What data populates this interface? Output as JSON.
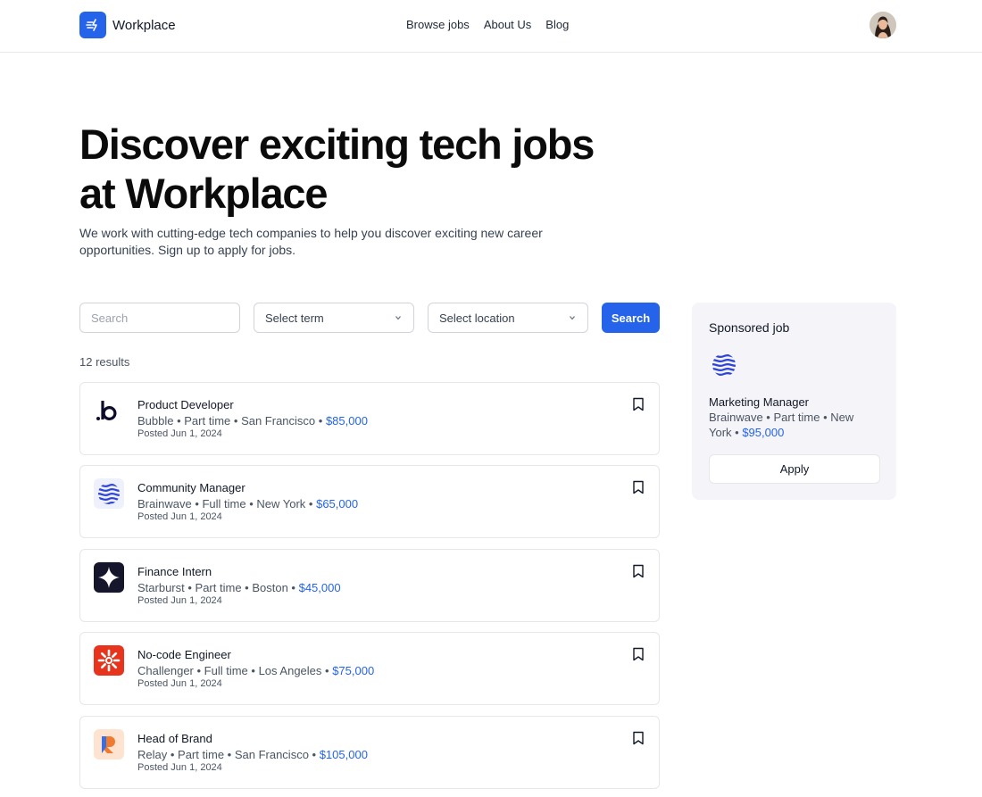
{
  "header": {
    "brand_name": "Workplace",
    "nav": [
      "Browse jobs",
      "About Us",
      "Blog"
    ]
  },
  "hero": {
    "title_line1": "Discover exciting tech jobs",
    "title_line2": "at Workplace",
    "subtitle_line1": "We work with cutting-edge tech companies to help you discover exciting new career",
    "subtitle_line2": "opportunities. Sign up to apply for jobs."
  },
  "filters": {
    "search_placeholder": "Search",
    "term_label": "Select term",
    "location_label": "Select location",
    "search_button": "Search"
  },
  "results": {
    "count_label": "12 results",
    "jobs": [
      {
        "title": "Product Developer",
        "company": "Bubble",
        "term": "Part time",
        "location": "San Francisco",
        "salary": "$85,000",
        "posted": "Posted Jun 1, 2024",
        "logo": "bubble-logo"
      },
      {
        "title": "Community Manager",
        "company": "Brainwave",
        "term": "Full time",
        "location": "New York",
        "salary": "$65,000",
        "posted": "Posted Jun 1, 2024",
        "logo": "brainwave-logo"
      },
      {
        "title": "Finance Intern",
        "company": "Starburst",
        "term": "Part time",
        "location": "Boston",
        "salary": "$45,000",
        "posted": "Posted Jun 1, 2024",
        "logo": "starburst-logo"
      },
      {
        "title": "No-code Engineer",
        "company": "Challenger",
        "term": "Full time",
        "location": "Los Angeles",
        "salary": "$75,000",
        "posted": "Posted Jun 1, 2024",
        "logo": "challenger-logo"
      },
      {
        "title": "Head of Brand",
        "company": "Relay",
        "term": "Part time",
        "location": "San Francisco",
        "salary": "$105,000",
        "posted": "Posted Jun 1, 2024",
        "logo": "relay-logo"
      }
    ]
  },
  "sponsored": {
    "heading": "Sponsored job",
    "title": "Marketing Manager",
    "meta_prefix": "Brainwave • Part time • New York • ",
    "salary": "$95,000",
    "apply_label": "Apply"
  },
  "colors": {
    "accent": "#2563eb",
    "sidebar_bg": "#f5f4f8",
    "challenger": "#e8341c",
    "starburst": "#15162b",
    "relay_bg": "#fde3d0"
  }
}
